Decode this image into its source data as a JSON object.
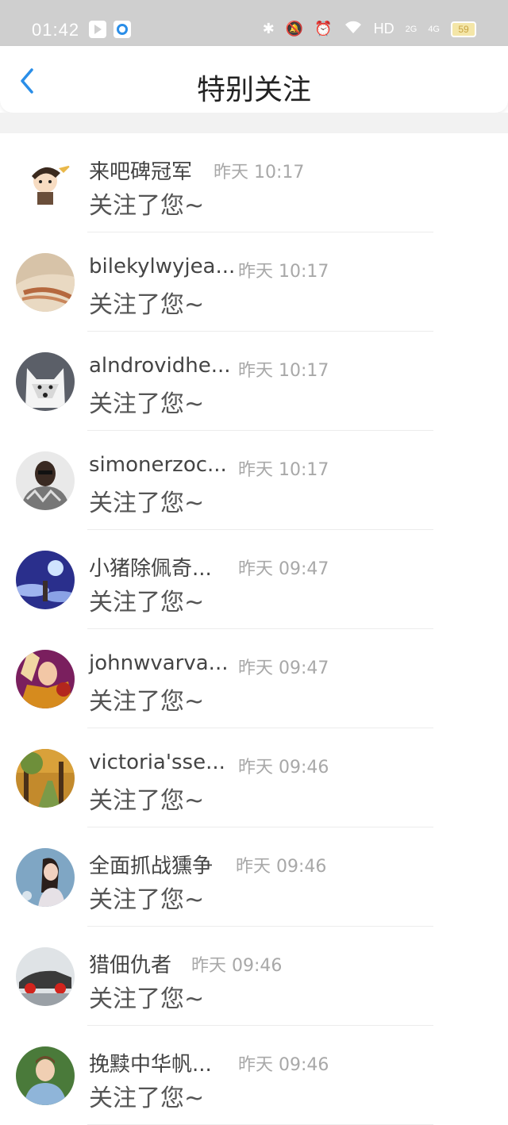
{
  "status_bar": {
    "time": "01:42",
    "hd": "HD",
    "signal1": "2G",
    "signal2": "4G",
    "battery": "59"
  },
  "header": {
    "title": "特别关注"
  },
  "items": [
    {
      "name": "来吧碑冠军",
      "time": "昨天 10:17",
      "message": "关注了您~"
    },
    {
      "name": "bilekylwyjea...",
      "time": "昨天 10:17",
      "message": "关注了您~"
    },
    {
      "name": "alndrovidhe...",
      "time": "昨天 10:17",
      "message": "关注了您~"
    },
    {
      "name": "simonerzoc...",
      "time": "昨天 10:17",
      "message": "关注了您~"
    },
    {
      "name": "小猪除佩奇...",
      "time": "昨天 09:47",
      "message": "关注了您~"
    },
    {
      "name": "johnwvarva...",
      "time": "昨天 09:47",
      "message": "关注了您~"
    },
    {
      "name": "victoria'sse...",
      "time": "昨天 09:46",
      "message": "关注了您~"
    },
    {
      "name": "全面抓战獯争",
      "time": "昨天 09:46",
      "message": "关注了您~"
    },
    {
      "name": "猎佃仇者",
      "time": "昨天 09:46",
      "message": "关注了您~"
    },
    {
      "name": "挽黩中华帆...",
      "time": "昨天 09:46",
      "message": "关注了您~"
    }
  ],
  "colors": {
    "accent": "#2a8ee8",
    "status_bar_bg": "#cfcfcf",
    "name_text": "#444444",
    "time_text": "#a8a8a8"
  }
}
